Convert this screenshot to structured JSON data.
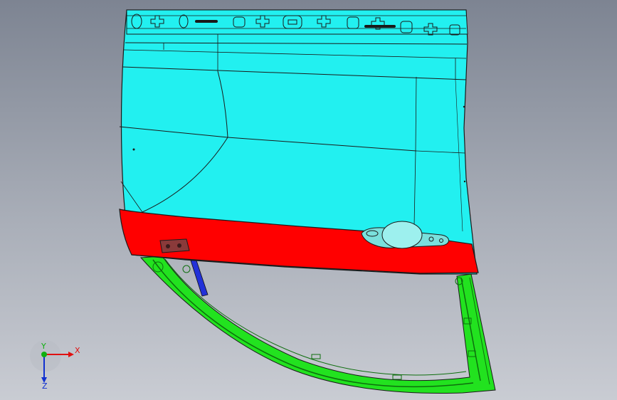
{
  "viewport": {
    "background_top": "#7d8492",
    "background_bottom": "#c9ccd3"
  },
  "model": {
    "panel_color": "#22f0f0",
    "lower_panel_color": "#ff0000",
    "frame_color": "#22e21f",
    "seal_color": "#2231d8",
    "edge_color": "#1a1a1a"
  },
  "triad": {
    "x_label": "X",
    "y_label": "Y",
    "z_label": "Z",
    "x_color": "#e01010",
    "y_color": "#10b010",
    "z_color": "#1030d0"
  }
}
